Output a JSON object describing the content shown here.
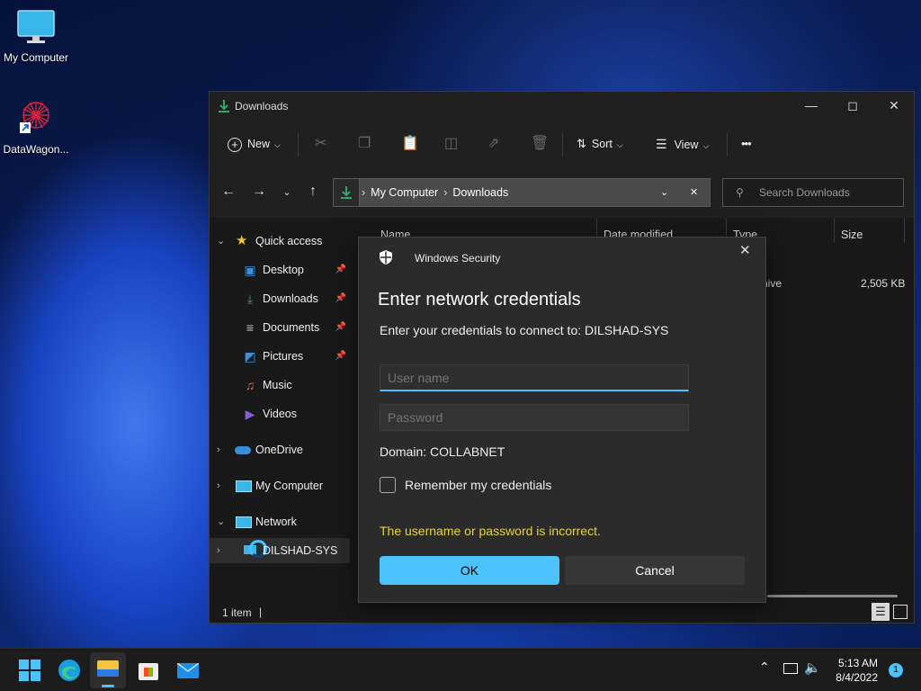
{
  "desktop": {
    "icons": [
      {
        "label": "My Computer"
      },
      {
        "label": "DataWagon..."
      }
    ]
  },
  "explorer": {
    "title": "Downloads",
    "toolbar": {
      "new_label": "New",
      "sort_label": "Sort",
      "view_label": "View",
      "more_label": "•••"
    },
    "address": {
      "crumbs": [
        "My Computer",
        "Downloads"
      ]
    },
    "search": {
      "placeholder": "Search Downloads"
    },
    "sidebar": {
      "quick_access": "Quick access",
      "items": [
        {
          "label": "Desktop",
          "pinned": true,
          "icon": "desktop-icon",
          "color": "#3a8fd8"
        },
        {
          "label": "Downloads",
          "pinned": true,
          "icon": "download-icon",
          "color": "#2fa86a"
        },
        {
          "label": "Documents",
          "pinned": true,
          "icon": "document-icon",
          "color": "#c8c8c8"
        },
        {
          "label": "Pictures",
          "pinned": true,
          "icon": "pictures-icon",
          "color": "#3a8fd8"
        },
        {
          "label": "Music",
          "pinned": false,
          "icon": "music-icon",
          "color": "#e0685a"
        },
        {
          "label": "Videos",
          "pinned": false,
          "icon": "videos-icon",
          "color": "#8a5bd6"
        }
      ],
      "onedrive": "OneDrive",
      "my_computer": "My Computer",
      "network": "Network",
      "network_child": "DILSHAD-SYS"
    },
    "columns": [
      "Name",
      "Date modified",
      "Type",
      "Size"
    ],
    "row": {
      "type_partial": "hive",
      "size": "2,505 KB"
    },
    "status": {
      "items": "1 item",
      "divider": "|"
    }
  },
  "dialog": {
    "app_name": "Windows Security",
    "title": "Enter network credentials",
    "subtitle": "Enter your credentials to connect to: DILSHAD-SYS",
    "username_placeholder": "User name",
    "password_placeholder": "Password",
    "domain": "Domain: COLLABNET",
    "remember_label": "Remember my credentials",
    "remember_checked": false,
    "error": "The username or password is incorrect.",
    "ok_label": "OK",
    "cancel_label": "Cancel",
    "accent": "#4cc2ff",
    "error_color": "#e6d43a"
  },
  "taskbar": {
    "time": "5:13 AM",
    "date": "8/4/2022",
    "notifications": "1"
  }
}
